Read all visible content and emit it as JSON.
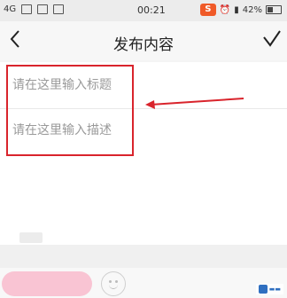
{
  "status_bar": {
    "network": "4G",
    "time": "00:21",
    "ime_logo": "S",
    "battery": "42%",
    "icons": [
      "screenshot-icon",
      "image-icon",
      "mail-icon",
      "alarm-icon",
      "signal-icon"
    ]
  },
  "header": {
    "title": "发布内容",
    "back_icon": "chevron-left-icon",
    "confirm_icon": "check-icon"
  },
  "form": {
    "title_placeholder": "请在这里输入标题",
    "description_placeholder": "请在这里输入描述"
  },
  "annotation": {
    "box_color": "#d9242c",
    "arrow_color": "#d9242c"
  },
  "bottom_bar": {
    "publish_label": "",
    "emoji_icon": "smiley-icon"
  },
  "colors": {
    "publish_button": "#f9c4d3",
    "background": "#f4f4f4"
  }
}
